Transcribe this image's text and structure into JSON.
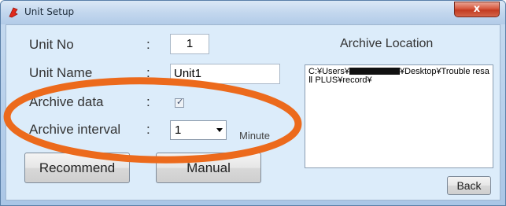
{
  "window": {
    "title": "Unit Setup",
    "close_glyph": "x"
  },
  "form": {
    "unit_no_label": "Unit No",
    "unit_no_value": "1",
    "unit_name_label": "Unit Name",
    "unit_name_value": "Unit1",
    "archive_data_label": "Archive data",
    "archive_data_checked": true,
    "archive_interval_label": "Archive interval",
    "archive_interval_value": "1",
    "minute_label": "Minute",
    "colon": ":"
  },
  "archive": {
    "title": "Archive Location",
    "path_prefix": "C:¥Users¥",
    "path_suffix": "¥Desktop¥Trouble resa Ⅱ PLUS¥record¥"
  },
  "buttons": {
    "recommend": "Recommend",
    "manual": "Manual",
    "back": "Back"
  },
  "annotation": {
    "color": "#ec6a1c"
  },
  "colors": {
    "close": "#c83a22",
    "client_bg": "#dcecfa"
  }
}
